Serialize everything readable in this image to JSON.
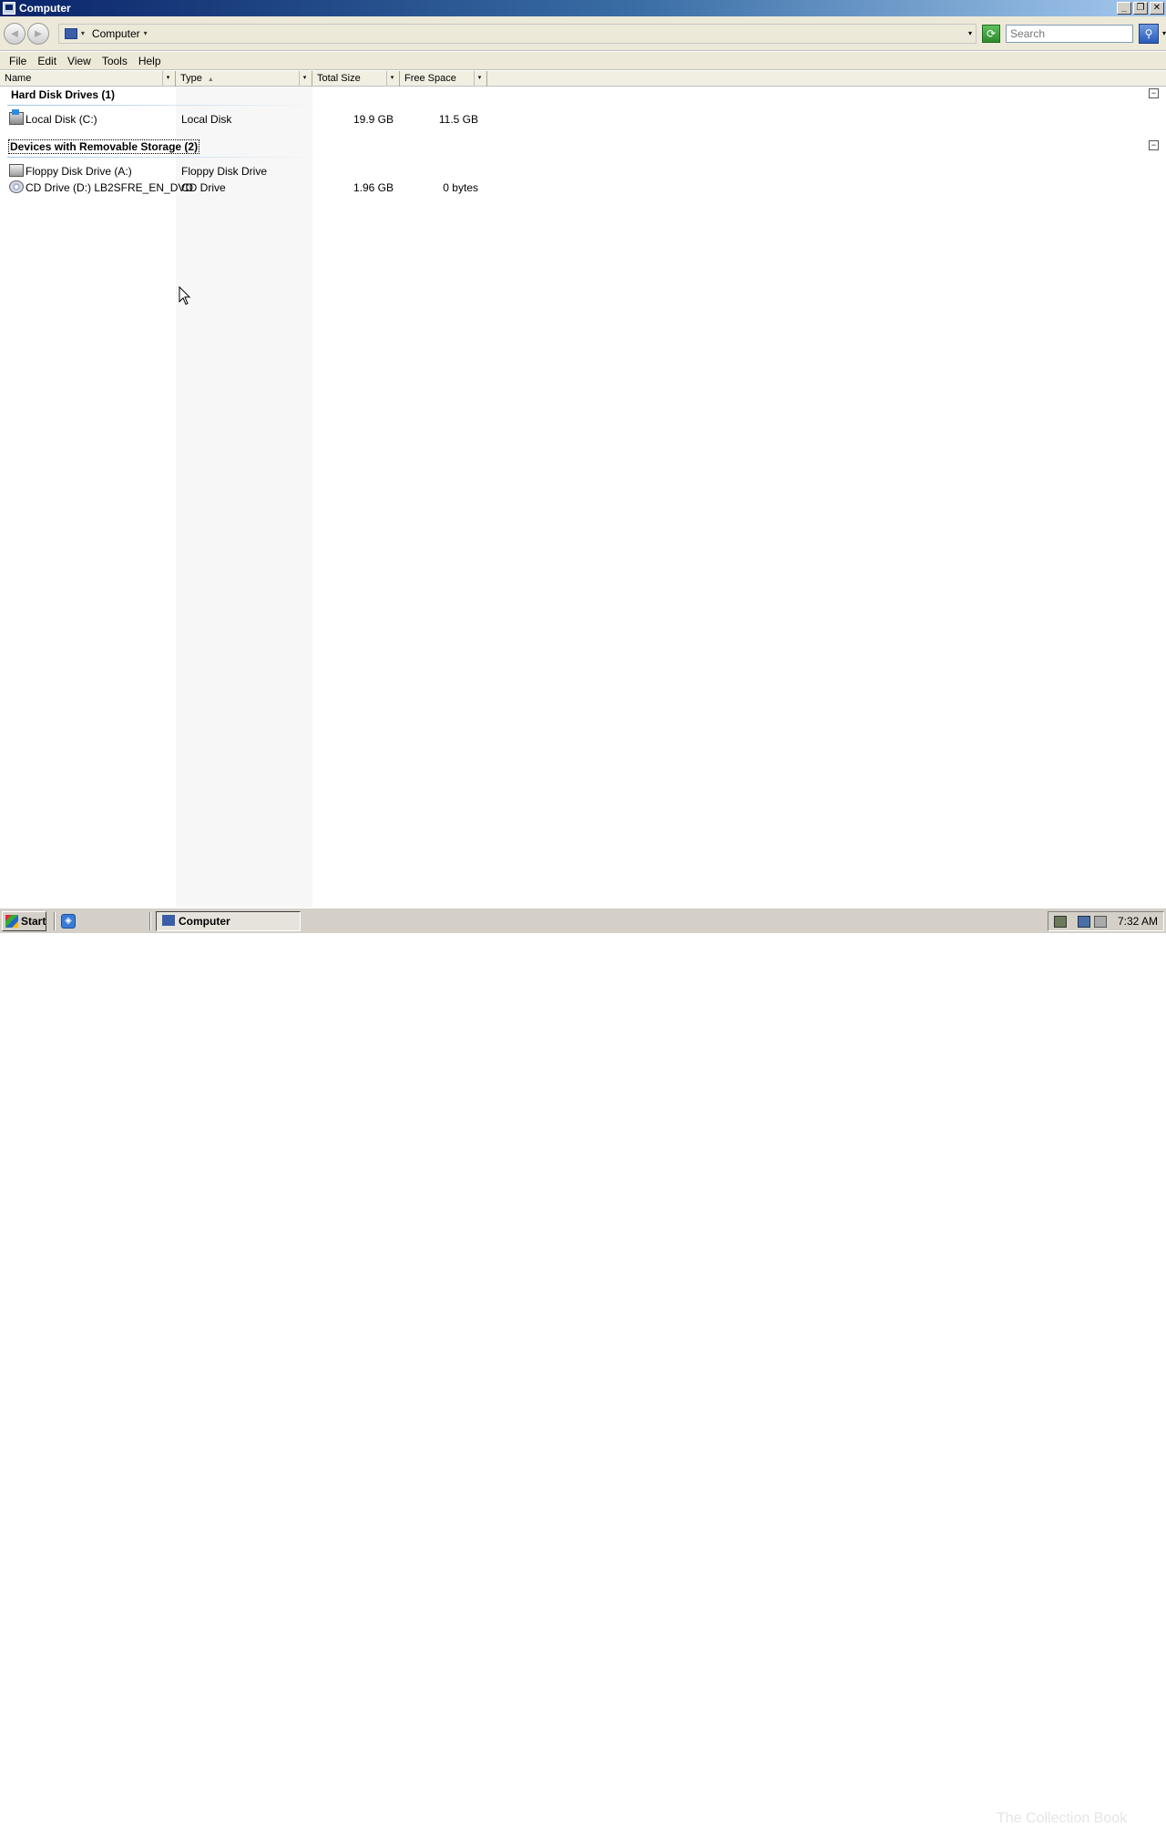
{
  "window": {
    "title": "Computer"
  },
  "window_buttons": {
    "minimize": "_",
    "restore": "❐",
    "close": "✕"
  },
  "address": {
    "back_glyph": "◄",
    "forward_glyph": "►",
    "location_icon": "computer-icon",
    "location": "Computer",
    "dropdown_glyph": "▾",
    "search_placeholder": "Search"
  },
  "menu": [
    "File",
    "Edit",
    "View",
    "Tools",
    "Help"
  ],
  "columns": {
    "name": "Name",
    "type": "Type",
    "total_size": "Total Size",
    "free_space": "Free Space",
    "sort_glyph": "▲",
    "filter_glyph": "▾"
  },
  "groups": [
    {
      "title": "Hard Disk Drives (1)",
      "collapse_glyph": "−",
      "items": [
        {
          "icon": "hard-disk-icon",
          "name": "Local Disk (C:)",
          "type": "Local Disk",
          "total": "19.9 GB",
          "free": "11.5 GB"
        }
      ]
    },
    {
      "title": "Devices with Removable Storage (2)",
      "collapse_glyph": "−",
      "items": [
        {
          "icon": "floppy-drive-icon",
          "name": "Floppy Disk Drive (A:)",
          "type": "Floppy Disk Drive",
          "total": "",
          "free": ""
        },
        {
          "icon": "cd-drive-icon",
          "name": "CD Drive (D:) LB2SFRE_EN_DVD",
          "type": "CD Drive",
          "total": "1.96 GB",
          "free": "0 bytes"
        }
      ]
    }
  ],
  "taskbar": {
    "start_label": "Start",
    "task_label": "Computer",
    "clock": "7:32 AM",
    "watermark": "The Collection Book"
  }
}
